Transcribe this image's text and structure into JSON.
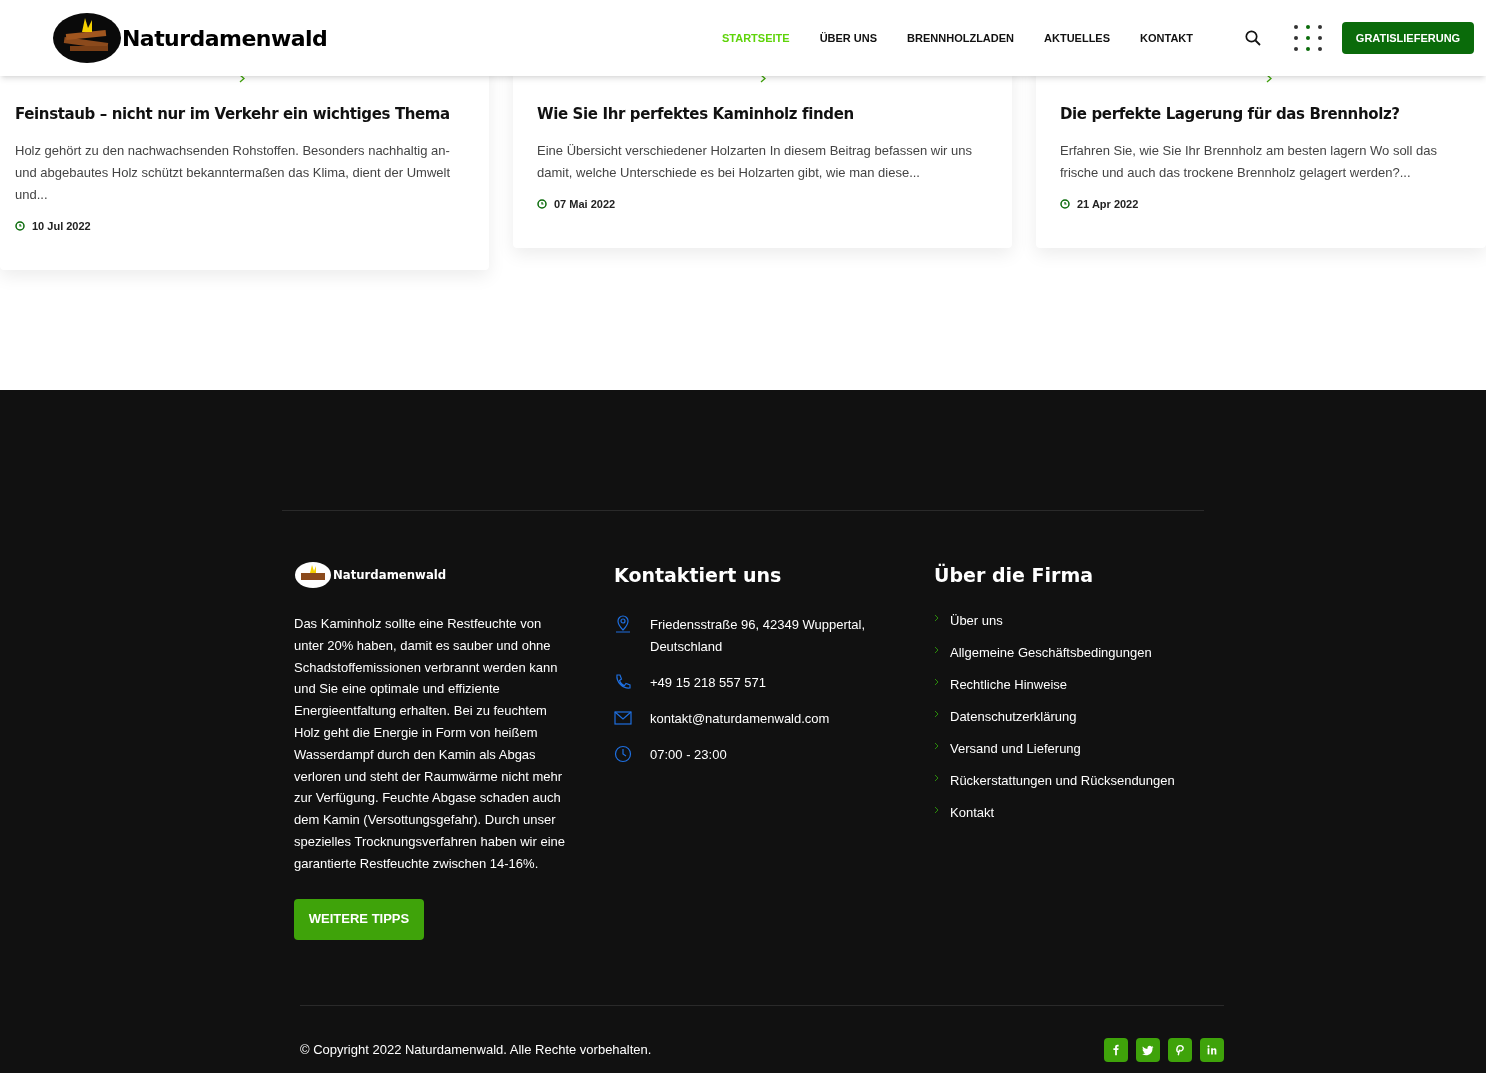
{
  "header": {
    "brand": "Naturdamenwald",
    "nav": [
      {
        "label": "STARTSEITE",
        "selected": true
      },
      {
        "label": "ÜBER UNS",
        "selected": false
      },
      {
        "label": "BRENNHOLZLADEN",
        "selected": false
      },
      {
        "label": "AKTUELLES",
        "selected": false
      },
      {
        "label": "KONTAKT",
        "selected": false
      }
    ],
    "cta": "GRATISLIEFERUNG"
  },
  "posts": [
    {
      "title": "Feinstaub – nicht nur im Verkehr ein wichtiges Thema",
      "excerpt": "Holz gehört zu den nachwachsenden Rohstoffen. Besonders nachhaltig an- und abgebautes Holz schützt bekanntermaßen das Klima, dient der Umwelt und...",
      "date": "10 Jul 2022"
    },
    {
      "title": "Wie Sie Ihr perfektes Kaminholz finden",
      "excerpt": "Eine Übersicht verschiedener Holzarten In diesem Beitrag befassen wir uns damit, welche Unterschiede es bei Holzarten gibt, wie man diese...",
      "date": "07 Mai 2022"
    },
    {
      "title": "Die perfekte Lagerung für das Brennholz?",
      "excerpt": "Erfahren Sie, wie Sie Ihr Brennholz am besten lagern Wo soll das frische und auch das trockene Brennholz gelagert werden?...",
      "date": "21 Apr 2022"
    }
  ],
  "footer": {
    "brand": "Naturdamenwald",
    "about": "Das Kaminholz sollte eine Restfeuchte von unter 20% haben, damit es sauber und ohne Schadstoffemissionen verbrannt werden kann und Sie eine optimale und effiziente Energieentfaltung erhalten. Bei zu feuchtem Holz geht die Energie in Form von heißem Wasserdampf durch den Kamin als Abgas verloren und steht der Raumwärme nicht mehr zur Verfügung. Feuchte Abgase schaden auch dem Kamin (Versottungsgefahr). Durch unser spezielles Trocknungsverfahren haben wir eine garantierte Restfeuchte zwischen 14-16%.",
    "button": "WEITERE TIPPS",
    "contact_title": "Kontaktiert uns",
    "contacts": [
      {
        "kind": "address",
        "text": "Friedensstraße 96, 42349 Wuppertal, Deutschland"
      },
      {
        "kind": "phone",
        "text": "+49 15 218 557 571"
      },
      {
        "kind": "email",
        "text": "kontakt@naturdamenwald.com"
      },
      {
        "kind": "hours",
        "text": "07:00 - 23:00"
      }
    ],
    "links_title": "Über die Firma",
    "links": [
      "Über uns",
      "Allgemeine Geschäftsbedingungen",
      "Rechtliche Hinweise",
      "Datenschutzerklärung",
      "Versand und Lieferung",
      "Rückerstattungen und Rücksendungen",
      "Kontakt"
    ],
    "copyright": "© Copyright 2022 Naturdamenwald. Alle Rechte vorbehalten.",
    "social": [
      {
        "kind": "f"
      },
      {
        "kind": "bird"
      },
      {
        "kind": "p"
      },
      {
        "kind": "in"
      }
    ]
  }
}
